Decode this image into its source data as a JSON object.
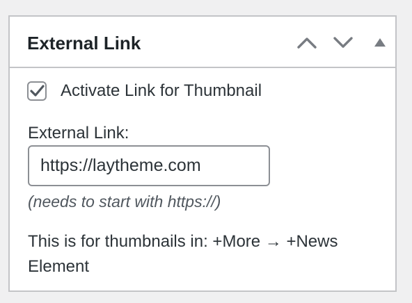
{
  "panel": {
    "title": "External Link",
    "move_up_icon": "chevron-up-icon",
    "move_down_icon": "chevron-down-icon",
    "toggle_icon": "triangle-up-icon"
  },
  "checkbox": {
    "checked": true,
    "label": "Activate Link for Thumbnail"
  },
  "link_field": {
    "label": "External Link:",
    "value": "https://laytheme.com"
  },
  "hint": "(needs to start with https://)",
  "info": "This is for thumbnails in: +More → +News Element",
  "colors": {
    "background": "#f0f0f1",
    "panel": "#ffffff",
    "border": "#c3c4c7",
    "text": "#2c3338",
    "icon": "#787c82"
  }
}
